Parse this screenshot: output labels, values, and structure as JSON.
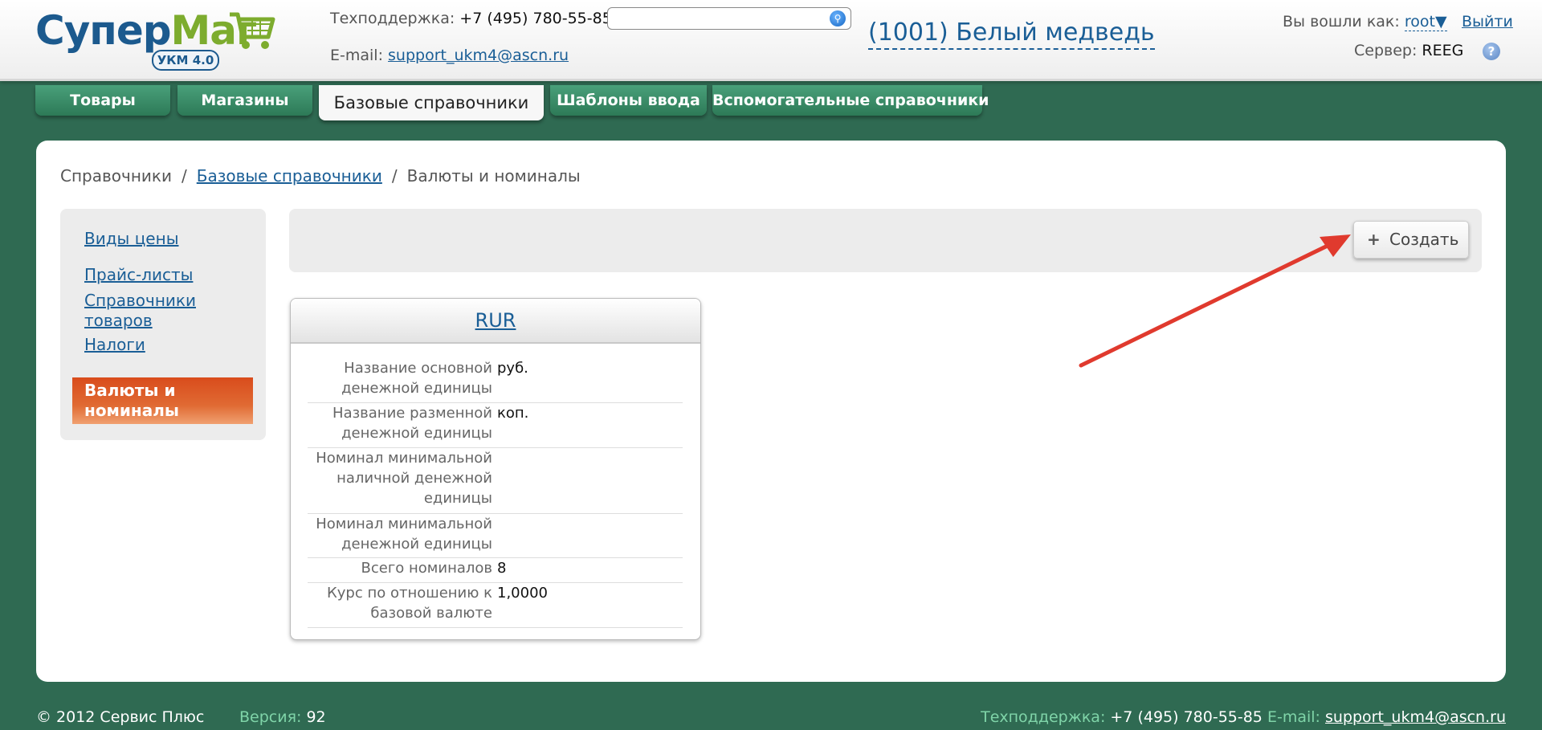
{
  "header": {
    "logo": {
      "word1": "Супер",
      "word2": "Маг",
      "badge": "УКМ 4.0"
    },
    "support_label": "Техподдержка:",
    "support_phone": "+7 (495) 780-55-85",
    "email_label": "E-mail:",
    "email": "support_ukm4@ascn.ru",
    "search": {
      "value": "",
      "placeholder": ""
    },
    "store": "(1001) Белый медведь",
    "login_label": "Вы вошли как:",
    "user": "root",
    "user_caret": "▼",
    "logout": "Выйти",
    "server_label": "Сервер:",
    "server": "REEG",
    "help": "?"
  },
  "tabs": [
    {
      "label": "Товары"
    },
    {
      "label": "Магазины"
    },
    {
      "label": "Базовые справочники"
    },
    {
      "label": "Шаблоны ввода"
    },
    {
      "label": "Вспомогательные справочники"
    }
  ],
  "breadcrumb": {
    "root": "Справочники",
    "parent": "Базовые справочники",
    "current": "Валюты и номиналы",
    "separator": "/"
  },
  "sidenav": {
    "items": [
      {
        "label": "Виды цены"
      },
      {
        "label": "Прайс-листы"
      },
      {
        "label": "Справочники товаров"
      },
      {
        "label": "Налоги"
      },
      {
        "label": "Валюты и номиналы"
      }
    ]
  },
  "toolbar": {
    "create_icon": "+",
    "create_label": "Создать"
  },
  "currency_card": {
    "title": "RUR",
    "rows": [
      {
        "label": "Название основной денежной единицы",
        "value": "руб."
      },
      {
        "label": "Название разменной денежной единицы",
        "value": "коп."
      },
      {
        "label": "Номинал минимальной наличной денежной единицы",
        "value": ""
      },
      {
        "label": "Номинал минимальной денежной единицы",
        "value": ""
      },
      {
        "label": "Всего номиналов",
        "value": "8"
      },
      {
        "label": "Курс по отношению к базовой валюте",
        "value": "1,0000"
      }
    ]
  },
  "footer": {
    "copyright": "© 2012 Сервис Плюс",
    "version_label": "Версия:",
    "version": "92",
    "support_label": "Техподдержка:",
    "support_phone": "+7 (495) 780-55-85",
    "email_label": "E-mail:",
    "email": "support_ukm4@ascn.ru"
  },
  "colors": {
    "brand_blue": "#1c5a8e",
    "brand_green": "#7dac2e",
    "background_green": "#2f6a52",
    "tab_green": "#3b8c66",
    "active_nav_orange": "#d94c1c",
    "arrow_red": "#e03a2e"
  }
}
